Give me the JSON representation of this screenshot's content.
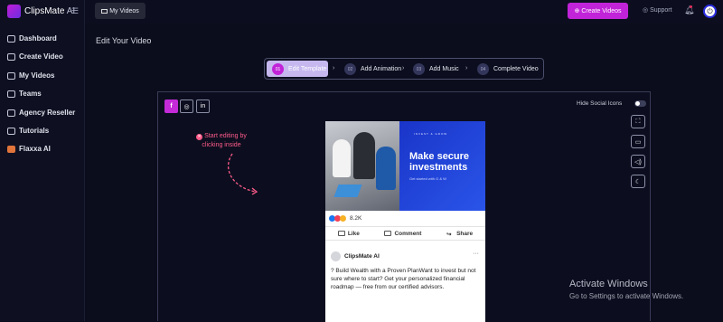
{
  "app": {
    "name": "ClipsMate",
    "name_suffix": "AI"
  },
  "sidebar": {
    "items": [
      {
        "label": "Dashboard",
        "icon": "grid-icon"
      },
      {
        "label": "Create Video",
        "icon": "plus-icon"
      },
      {
        "label": "My Videos",
        "icon": "video-icon"
      },
      {
        "label": "Teams",
        "icon": "users-icon"
      },
      {
        "label": "Agency Reseller",
        "icon": "user-icon"
      },
      {
        "label": "Tutorials",
        "icon": "book-icon"
      },
      {
        "label": "Flaxxa AI",
        "icon": "book-icon"
      }
    ]
  },
  "topbar": {
    "my_videos_label": "My Videos",
    "create_videos_label": "Create Videos",
    "support_label": "Support"
  },
  "page": {
    "title": "Edit Your Video"
  },
  "stepper": {
    "steps": [
      {
        "num": "01",
        "label": "Edit Template"
      },
      {
        "num": "02",
        "label": "Add Animation"
      },
      {
        "num": "03",
        "label": "Add Music"
      },
      {
        "num": "04",
        "label": "Complete Video"
      }
    ]
  },
  "editor": {
    "social": {
      "facebook": "f",
      "instagram": "◎",
      "linkedin": "in"
    },
    "hide_social_label": "Hide Social Icons",
    "hint_line1": "Start editing by",
    "hint_line2": "clicking inside"
  },
  "post": {
    "logo_text": "INVEST & GROW",
    "headline": "Make secure investments",
    "subline": "Get started with G & W",
    "reaction_count": "8.2K",
    "like_label": "Like",
    "comment_label": "Comment",
    "share_label": "Share",
    "page_name": "ClipsMate AI",
    "more": "···",
    "body": "? Build Wealth with a Proven PlanWant to invest but not sure where to start? Get your personalized financial roadmap — free from our certified advisors."
  },
  "watermark": {
    "title": "Activate Windows",
    "subtitle": "Go to Settings to activate Windows."
  },
  "colors": {
    "accent": "#c123d8",
    "background": "#0b0d1c",
    "post_blue": "#1a35c9"
  }
}
